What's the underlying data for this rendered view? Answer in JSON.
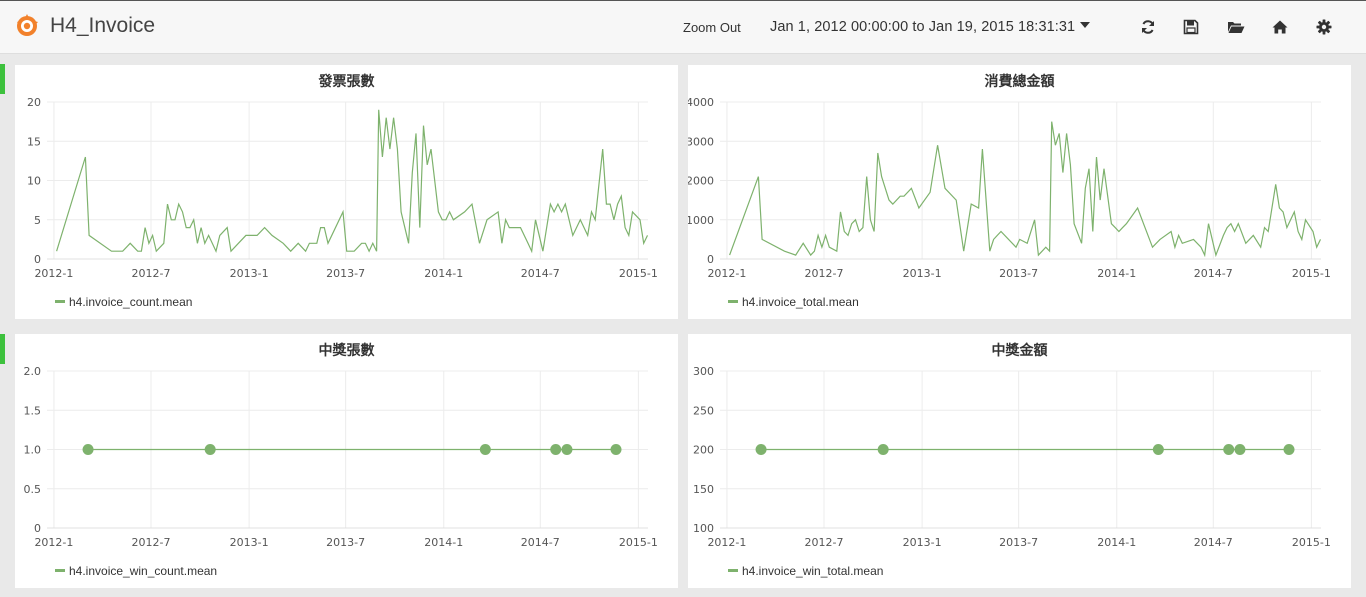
{
  "dashboard": {
    "title": "H4_Invoice"
  },
  "toolbar": {
    "zoom_out": "Zoom Out",
    "time_range": "Jan 1, 2012 00:00:00 to Jan 19, 2015 18:31:31",
    "icons": [
      "refresh-icon",
      "save-icon",
      "folder-open-icon",
      "home-icon",
      "gear-icon"
    ]
  },
  "colors": {
    "series": "#7eb26d",
    "grid": "#ececec",
    "row_marker": "#3dc13d"
  },
  "panels": [
    {
      "title": "發票張數",
      "legend": "h4.invoice_count.mean"
    },
    {
      "title": "消費總金額",
      "legend": "h4.invoice_total.mean"
    },
    {
      "title": "中獎張數",
      "legend": "h4.invoice_win_count.mean"
    },
    {
      "title": "中獎金額",
      "legend": "h4.invoice_win_total.mean"
    }
  ],
  "chart_data": [
    {
      "type": "line",
      "title": "發票張數",
      "x_type": "time",
      "xlim": [
        "2011-12-19",
        "2015-01-19"
      ],
      "x_ticks": [
        "2012-1",
        "2012-7",
        "2013-1",
        "2013-7",
        "2014-1",
        "2014-7",
        "2015-1"
      ],
      "ylim": [
        0,
        20
      ],
      "y_ticks": [
        "0",
        "5",
        "10",
        "15",
        "20"
      ],
      "grid": true,
      "legend_position": "bottom-left",
      "series": [
        {
          "name": "h4.invoice_count.mean",
          "points": [
            [
              "2012-01-06",
              1
            ],
            [
              "2012-02-29",
              13
            ],
            [
              "2012-03-07",
              3
            ],
            [
              "2012-04-18",
              1
            ],
            [
              "2012-05-09",
              1
            ],
            [
              "2012-05-23",
              2
            ],
            [
              "2012-06-06",
              1
            ],
            [
              "2012-06-13",
              1
            ],
            [
              "2012-06-20",
              4
            ],
            [
              "2012-06-27",
              2
            ],
            [
              "2012-07-04",
              3
            ],
            [
              "2012-07-11",
              1
            ],
            [
              "2012-07-25",
              2
            ],
            [
              "2012-08-01",
              7
            ],
            [
              "2012-08-08",
              5
            ],
            [
              "2012-08-15",
              5
            ],
            [
              "2012-08-22",
              7
            ],
            [
              "2012-08-29",
              6
            ],
            [
              "2012-09-05",
              4
            ],
            [
              "2012-09-12",
              4
            ],
            [
              "2012-09-19",
              5
            ],
            [
              "2012-09-26",
              2
            ],
            [
              "2012-10-03",
              4
            ],
            [
              "2012-10-10",
              2
            ],
            [
              "2012-10-17",
              3
            ],
            [
              "2012-10-31",
              1
            ],
            [
              "2012-11-07",
              3
            ],
            [
              "2012-11-21",
              4
            ],
            [
              "2012-11-28",
              1
            ],
            [
              "2012-12-12",
              2
            ],
            [
              "2012-12-26",
              3
            ],
            [
              "2013-01-16",
              3
            ],
            [
              "2013-01-30",
              4
            ],
            [
              "2013-02-13",
              3
            ],
            [
              "2013-03-06",
              2
            ],
            [
              "2013-03-20",
              1
            ],
            [
              "2013-04-03",
              2
            ],
            [
              "2013-04-17",
              1
            ],
            [
              "2013-04-24",
              2
            ],
            [
              "2013-05-08",
              2
            ],
            [
              "2013-05-15",
              4
            ],
            [
              "2013-05-22",
              4
            ],
            [
              "2013-05-29",
              2
            ],
            [
              "2013-06-26",
              6
            ],
            [
              "2013-07-03",
              1
            ],
            [
              "2013-07-17",
              1
            ],
            [
              "2013-07-31",
              2
            ],
            [
              "2013-08-07",
              2
            ],
            [
              "2013-08-14",
              1
            ],
            [
              "2013-08-21",
              2
            ],
            [
              "2013-08-28",
              1
            ],
            [
              "2013-09-01",
              19
            ],
            [
              "2013-09-08",
              13
            ],
            [
              "2013-09-15",
              18
            ],
            [
              "2013-09-22",
              14
            ],
            [
              "2013-09-29",
              18
            ],
            [
              "2013-10-06",
              14
            ],
            [
              "2013-10-13",
              6
            ],
            [
              "2013-10-27",
              2
            ],
            [
              "2013-11-03",
              11
            ],
            [
              "2013-11-10",
              16
            ],
            [
              "2013-11-17",
              4
            ],
            [
              "2013-11-24",
              17
            ],
            [
              "2013-12-01",
              12
            ],
            [
              "2013-12-08",
              14
            ],
            [
              "2013-12-22",
              6
            ],
            [
              "2013-12-29",
              5
            ],
            [
              "2014-01-05",
              5
            ],
            [
              "2014-01-12",
              6
            ],
            [
              "2014-01-19",
              5
            ],
            [
              "2014-02-09",
              6
            ],
            [
              "2014-02-23",
              7
            ],
            [
              "2014-03-09",
              2
            ],
            [
              "2014-03-23",
              5
            ],
            [
              "2014-04-13",
              6
            ],
            [
              "2014-04-20",
              2
            ],
            [
              "2014-04-27",
              5
            ],
            [
              "2014-05-04",
              4
            ],
            [
              "2014-05-25",
              4
            ],
            [
              "2014-06-08",
              2
            ],
            [
              "2014-06-15",
              1
            ],
            [
              "2014-06-22",
              5
            ],
            [
              "2014-07-06",
              1
            ],
            [
              "2014-07-20",
              7
            ],
            [
              "2014-07-27",
              6
            ],
            [
              "2014-08-03",
              7
            ],
            [
              "2014-08-10",
              6
            ],
            [
              "2014-08-17",
              7
            ],
            [
              "2014-08-31",
              3
            ],
            [
              "2014-09-14",
              5
            ],
            [
              "2014-09-28",
              3
            ],
            [
              "2014-10-05",
              6
            ],
            [
              "2014-10-12",
              5
            ],
            [
              "2014-10-26",
              14
            ],
            [
              "2014-11-02",
              7
            ],
            [
              "2014-11-09",
              7
            ],
            [
              "2014-11-16",
              5
            ],
            [
              "2014-11-23",
              7
            ],
            [
              "2014-11-30",
              8
            ],
            [
              "2014-12-07",
              4
            ],
            [
              "2014-12-14",
              3
            ],
            [
              "2014-12-21",
              6
            ],
            [
              "2015-01-04",
              5
            ],
            [
              "2015-01-11",
              2
            ],
            [
              "2015-01-18",
              3
            ]
          ]
        }
      ]
    },
    {
      "type": "line",
      "title": "消費總金額",
      "x_type": "time",
      "xlim": [
        "2011-12-19",
        "2015-01-19"
      ],
      "x_ticks": [
        "2012-1",
        "2012-7",
        "2013-1",
        "2013-7",
        "2014-1",
        "2014-7",
        "2015-1"
      ],
      "ylim": [
        0,
        4000
      ],
      "y_ticks": [
        "0",
        "1000",
        "2000",
        "3000",
        "4000"
      ],
      "grid": true,
      "legend_position": "bottom-left",
      "series": [
        {
          "name": "h4.invoice_total.mean",
          "points": [
            [
              "2012-01-06",
              100
            ],
            [
              "2012-02-29",
              2100
            ],
            [
              "2012-03-07",
              500
            ],
            [
              "2012-04-18",
              200
            ],
            [
              "2012-05-09",
              100
            ],
            [
              "2012-05-23",
              400
            ],
            [
              "2012-06-06",
              100
            ],
            [
              "2012-06-13",
              200
            ],
            [
              "2012-06-20",
              600
            ],
            [
              "2012-06-27",
              300
            ],
            [
              "2012-07-04",
              600
            ],
            [
              "2012-07-11",
              300
            ],
            [
              "2012-07-25",
              200
            ],
            [
              "2012-08-01",
              1200
            ],
            [
              "2012-08-08",
              700
            ],
            [
              "2012-08-15",
              600
            ],
            [
              "2012-08-22",
              900
            ],
            [
              "2012-08-29",
              1000
            ],
            [
              "2012-09-05",
              700
            ],
            [
              "2012-09-12",
              800
            ],
            [
              "2012-09-19",
              2100
            ],
            [
              "2012-09-26",
              1000
            ],
            [
              "2012-10-03",
              700
            ],
            [
              "2012-10-10",
              2700
            ],
            [
              "2012-10-17",
              2100
            ],
            [
              "2012-10-31",
              1500
            ],
            [
              "2012-11-07",
              1400
            ],
            [
              "2012-11-21",
              1600
            ],
            [
              "2012-11-28",
              1600
            ],
            [
              "2012-12-12",
              1800
            ],
            [
              "2012-12-26",
              1300
            ],
            [
              "2013-01-16",
              1700
            ],
            [
              "2013-01-30",
              2900
            ],
            [
              "2013-02-13",
              1800
            ],
            [
              "2013-03-06",
              1500
            ],
            [
              "2013-03-20",
              200
            ],
            [
              "2013-04-03",
              1400
            ],
            [
              "2013-04-17",
              1300
            ],
            [
              "2013-04-24",
              2800
            ],
            [
              "2013-05-08",
              200
            ],
            [
              "2013-05-15",
              500
            ],
            [
              "2013-05-22",
              600
            ],
            [
              "2013-05-29",
              700
            ],
            [
              "2013-06-26",
              300
            ],
            [
              "2013-07-03",
              500
            ],
            [
              "2013-07-17",
              400
            ],
            [
              "2013-07-31",
              1000
            ],
            [
              "2013-08-07",
              100
            ],
            [
              "2013-08-14",
              200
            ],
            [
              "2013-08-21",
              300
            ],
            [
              "2013-08-28",
              200
            ],
            [
              "2013-09-01",
              3500
            ],
            [
              "2013-09-08",
              2900
            ],
            [
              "2013-09-15",
              3200
            ],
            [
              "2013-09-22",
              2200
            ],
            [
              "2013-09-29",
              3200
            ],
            [
              "2013-10-06",
              2400
            ],
            [
              "2013-10-13",
              900
            ],
            [
              "2013-10-27",
              400
            ],
            [
              "2013-11-03",
              1800
            ],
            [
              "2013-11-10",
              2300
            ],
            [
              "2013-11-17",
              700
            ],
            [
              "2013-11-24",
              2600
            ],
            [
              "2013-12-01",
              1500
            ],
            [
              "2013-12-08",
              2300
            ],
            [
              "2013-12-22",
              900
            ],
            [
              "2013-12-29",
              800
            ],
            [
              "2014-01-05",
              700
            ],
            [
              "2014-01-12",
              800
            ],
            [
              "2014-01-19",
              900
            ],
            [
              "2014-02-09",
              1300
            ],
            [
              "2014-02-23",
              800
            ],
            [
              "2014-03-09",
              300
            ],
            [
              "2014-03-23",
              500
            ],
            [
              "2014-04-13",
              700
            ],
            [
              "2014-04-20",
              300
            ],
            [
              "2014-04-27",
              600
            ],
            [
              "2014-05-04",
              400
            ],
            [
              "2014-05-25",
              500
            ],
            [
              "2014-06-08",
              300
            ],
            [
              "2014-06-15",
              100
            ],
            [
              "2014-06-22",
              900
            ],
            [
              "2014-07-06",
              100
            ],
            [
              "2014-07-20",
              600
            ],
            [
              "2014-07-27",
              800
            ],
            [
              "2014-08-03",
              900
            ],
            [
              "2014-08-10",
              700
            ],
            [
              "2014-08-17",
              900
            ],
            [
              "2014-08-31",
              400
            ],
            [
              "2014-09-14",
              600
            ],
            [
              "2014-09-28",
              300
            ],
            [
              "2014-10-05",
              800
            ],
            [
              "2014-10-12",
              700
            ],
            [
              "2014-10-26",
              1900
            ],
            [
              "2014-11-02",
              1300
            ],
            [
              "2014-11-09",
              1200
            ],
            [
              "2014-11-16",
              800
            ],
            [
              "2014-11-23",
              1000
            ],
            [
              "2014-11-30",
              1200
            ],
            [
              "2014-12-07",
              700
            ],
            [
              "2014-12-14",
              500
            ],
            [
              "2014-12-21",
              1000
            ],
            [
              "2015-01-04",
              700
            ],
            [
              "2015-01-11",
              300
            ],
            [
              "2015-01-18",
              500
            ]
          ]
        }
      ]
    },
    {
      "type": "scatter",
      "title": "中獎張數",
      "x_type": "time",
      "xlim": [
        "2011-12-19",
        "2015-01-19"
      ],
      "x_ticks": [
        "2012-1",
        "2012-7",
        "2013-1",
        "2013-7",
        "2014-1",
        "2014-7",
        "2015-1"
      ],
      "ylim": [
        0,
        2
      ],
      "y_ticks": [
        "0",
        "0.5",
        "1.0",
        "1.5",
        "2.0"
      ],
      "grid": true,
      "connected": true,
      "legend_position": "bottom-left",
      "series": [
        {
          "name": "h4.invoice_win_count.mean",
          "points": [
            [
              "2012-03-05",
              1
            ],
            [
              "2012-10-20",
              1
            ],
            [
              "2014-03-20",
              1
            ],
            [
              "2014-07-30",
              1
            ],
            [
              "2014-08-20",
              1
            ],
            [
              "2014-11-20",
              1
            ]
          ]
        }
      ]
    },
    {
      "type": "scatter",
      "title": "中獎金額",
      "x_type": "time",
      "xlim": [
        "2011-12-19",
        "2015-01-19"
      ],
      "x_ticks": [
        "2012-1",
        "2012-7",
        "2013-1",
        "2013-7",
        "2014-1",
        "2014-7",
        "2015-1"
      ],
      "ylim": [
        100,
        300
      ],
      "y_ticks": [
        "100",
        "150",
        "200",
        "250",
        "300"
      ],
      "grid": true,
      "connected": true,
      "legend_position": "bottom-left",
      "series": [
        {
          "name": "h4.invoice_win_total.mean",
          "points": [
            [
              "2012-03-05",
              200
            ],
            [
              "2012-10-20",
              200
            ],
            [
              "2014-03-20",
              200
            ],
            [
              "2014-07-30",
              200
            ],
            [
              "2014-08-20",
              200
            ],
            [
              "2014-11-20",
              200
            ]
          ]
        }
      ]
    }
  ]
}
